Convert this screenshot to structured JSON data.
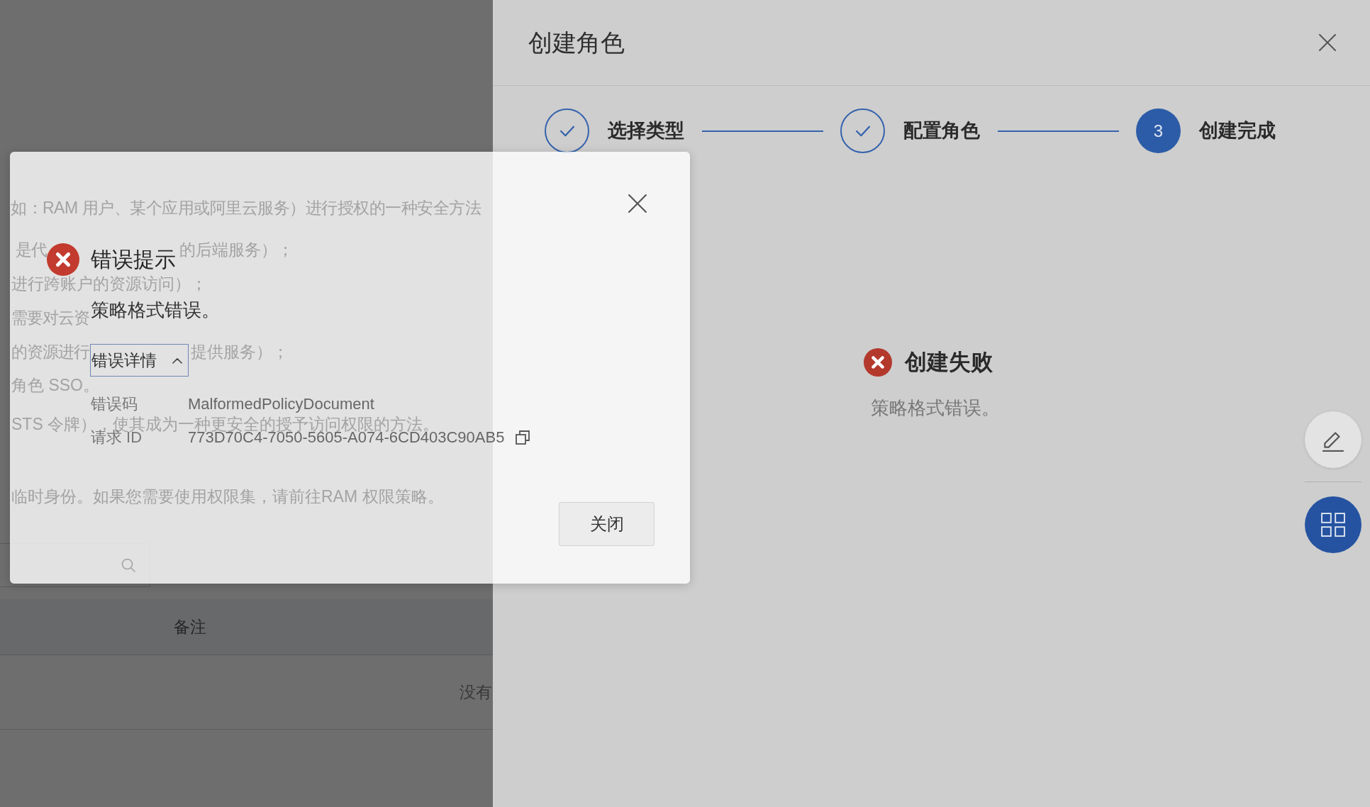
{
  "background_page": {
    "text_lines": [
      [
        "如：RAM 用户、某个应用或阿里云服务）进行授权的一种安全方法"
      ],
      [
        "是代",
        "的后端服务）；"
      ],
      [
        "进行跨账户的资源访问）；"
      ],
      [
        "需要对云资"
      ],
      [
        "的资源进行",
        "提供服务）；"
      ],
      [
        "角色 SSO。"
      ],
      [
        "STS 令牌），使其成为一种更安全的授予访问权限的方法。"
      ],
      [
        "临时身份。如果您需要使用权限集，请前往RAM 权限策略。"
      ]
    ],
    "table": {
      "columns": [
        "备注"
      ],
      "empty_text": "没有"
    }
  },
  "drawer": {
    "title": "创建角色",
    "steps": [
      {
        "label": "选择类型",
        "done": true,
        "active": false
      },
      {
        "label": "配置角色",
        "done": true,
        "active": false
      },
      {
        "label": "创建完成",
        "number": "3",
        "done": false,
        "active": true
      }
    ],
    "result": {
      "kind": "error",
      "title": "创建失败",
      "message": "策略格式错误。"
    }
  },
  "dialog": {
    "kind": "error",
    "title": "错误提示",
    "message": "策略格式错误。",
    "details_toggle": {
      "label": "错误详情",
      "expanded": true
    },
    "details": [
      {
        "label": "错误码",
        "value": "MalformedPolicyDocument",
        "copyable": false
      },
      {
        "label": "请求 ID",
        "value": "773D70C4-7050-5605-A074-6CD403C90AB5",
        "copyable": true
      }
    ],
    "buttons": [
      "关闭"
    ]
  }
}
